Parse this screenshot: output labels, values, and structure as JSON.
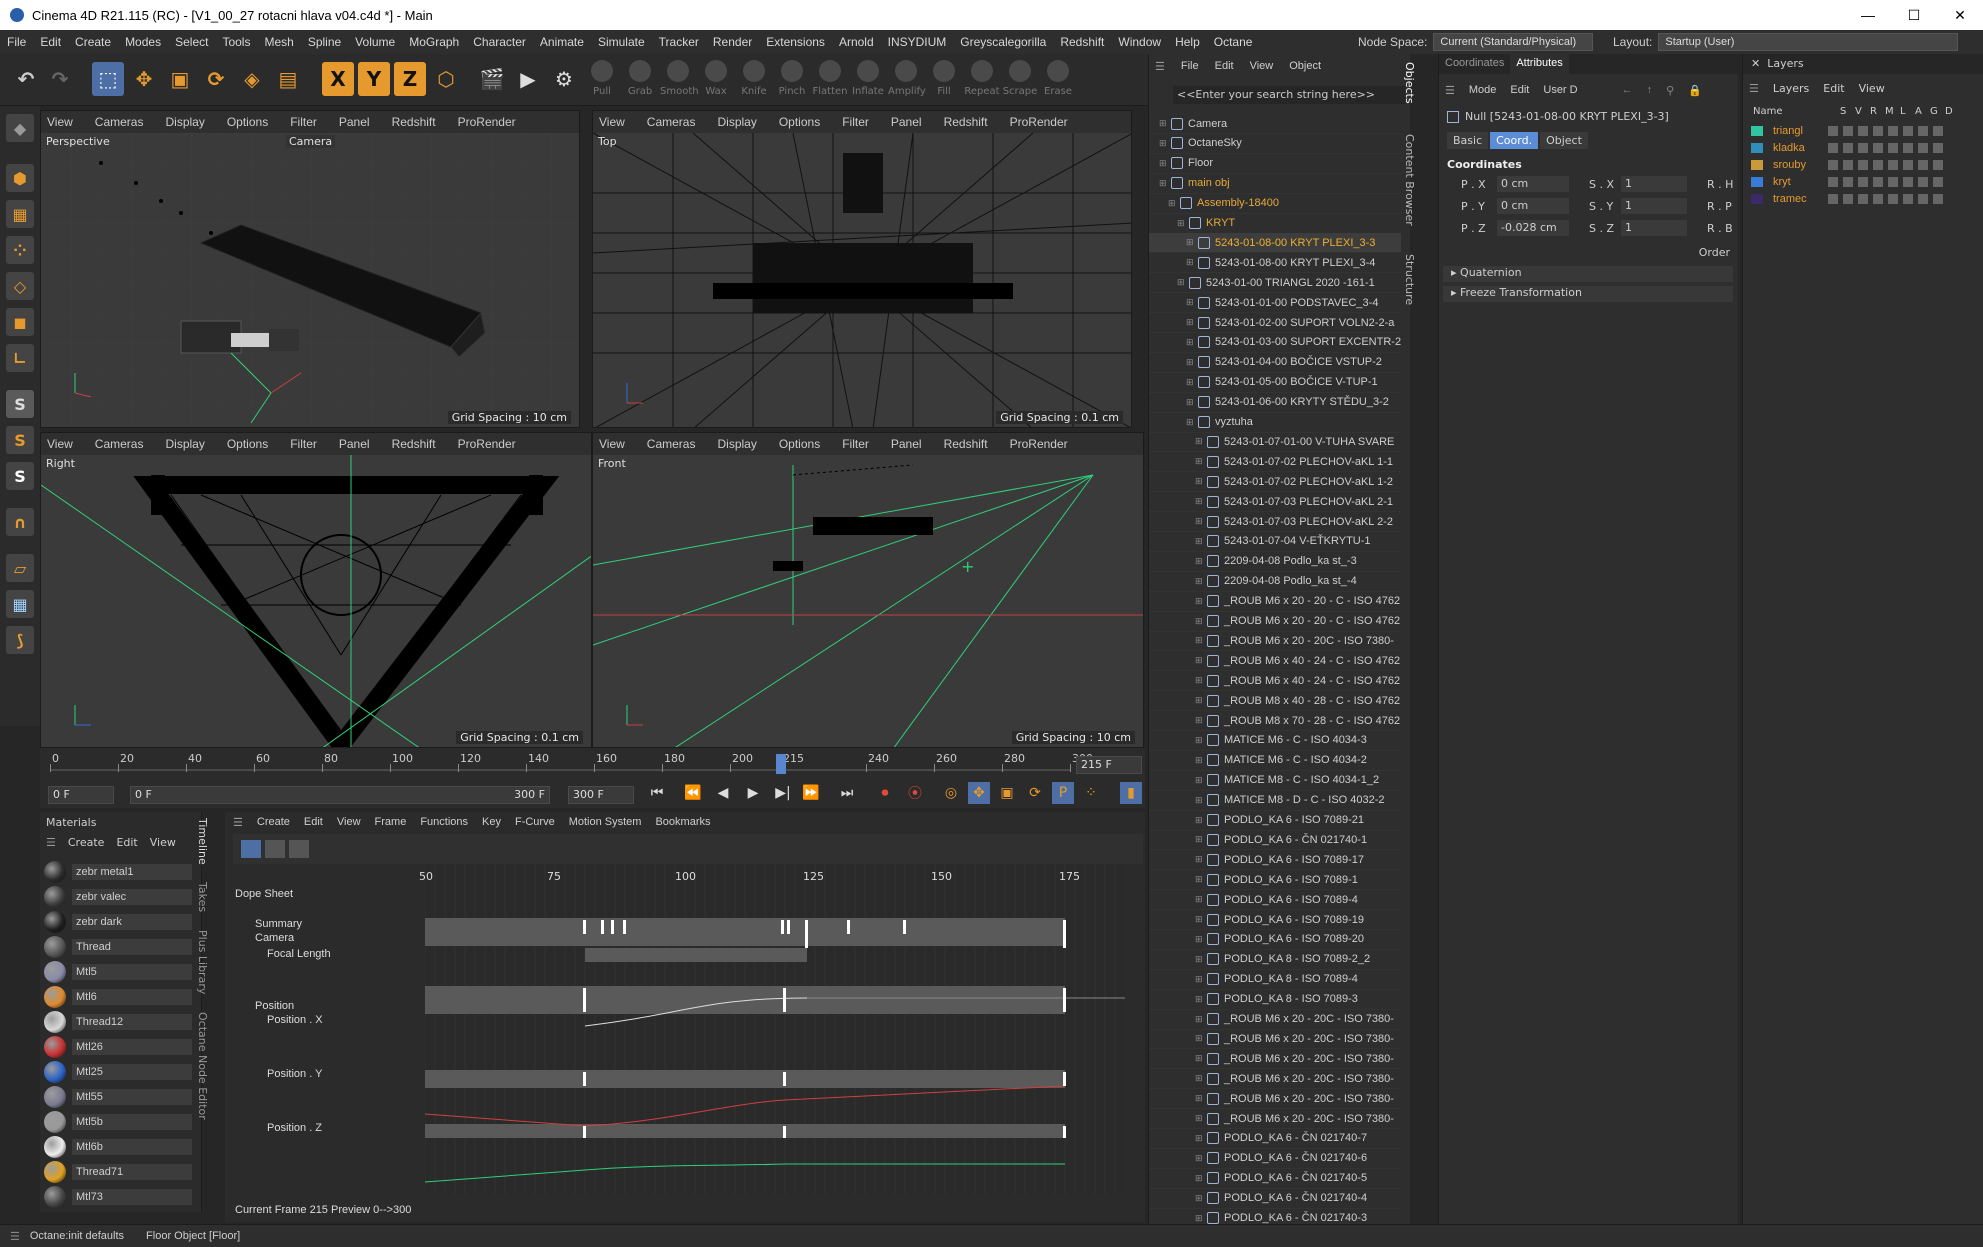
{
  "window": {
    "title": "Cinema 4D R21.115 (RC) - [V1_00_27 rotacni hlava v04.c4d *] - Main",
    "min": "—",
    "max": "☐",
    "close": "✕"
  },
  "menu": [
    "File",
    "Edit",
    "Create",
    "Modes",
    "Select",
    "Tools",
    "Mesh",
    "Spline",
    "Volume",
    "MoGraph",
    "Character",
    "Animate",
    "Simulate",
    "Tracker",
    "Render",
    "Extensions",
    "Arnold",
    "INSYDIUM",
    "Greyscalegorilla",
    "Redshift",
    "Window",
    "Help",
    "Octane"
  ],
  "node_space": {
    "label": "Node Space:",
    "value": "Current (Standard/Physical)"
  },
  "layout": {
    "label": "Layout:",
    "value": "Startup (User)"
  },
  "sculpt_tools": [
    "Pull",
    "Grab",
    "Smooth",
    "Wax",
    "Knife",
    "Pinch",
    "Flatten",
    "Inflate",
    "Amplify",
    "Fill",
    "Repeat",
    "Scrape",
    "Erase"
  ],
  "axis_buttons": [
    "X",
    "Y",
    "Z"
  ],
  "viewport_menu": [
    "View",
    "Cameras",
    "Display",
    "Options",
    "Filter",
    "Panel",
    "Redshift",
    "ProRender"
  ],
  "viewports": [
    {
      "label": "Perspective",
      "camera": "Camera",
      "grid": "Grid Spacing : 10 cm"
    },
    {
      "label": "Top",
      "grid": "Grid Spacing : 0.1 cm"
    },
    {
      "label": "Right",
      "grid": "Grid Spacing : 0.1 cm"
    },
    {
      "label": "Front",
      "grid": "Grid Spacing : 10 cm"
    }
  ],
  "timeline": {
    "ruler": [
      "0",
      "20",
      "40",
      "60",
      "80",
      "100",
      "120",
      "140",
      "160",
      "180",
      "200",
      "215",
      "240",
      "260",
      "280",
      "300"
    ],
    "end_frame": "215 F",
    "start": "0 F",
    "min": "0 F",
    "max": "300 F",
    "end": "300 F"
  },
  "materials": {
    "tab": "Materials",
    "menu": [
      "Create",
      "Edit",
      "View"
    ],
    "items": [
      {
        "name": "zebr metal1",
        "color": "#2a2a2a"
      },
      {
        "name": "zebr valec",
        "color": "#3a3a3a"
      },
      {
        "name": "zebr dark",
        "color": "#1e1e1e"
      },
      {
        "name": "Thread",
        "color": "#555555"
      },
      {
        "name": "Mtl5",
        "color": "#8a8aa8"
      },
      {
        "name": "Mtl6",
        "color": "#e08a2e"
      },
      {
        "name": "Thread12",
        "color": "#d8d8d8"
      },
      {
        "name": "Mtl26",
        "color": "#c83030"
      },
      {
        "name": "Mtl25",
        "color": "#2a62c8"
      },
      {
        "name": "Mtl55",
        "color": "#7a7a90"
      },
      {
        "name": "Mtl5b",
        "color": "#999999"
      },
      {
        "name": "Mtl6b",
        "color": "#eeeeee"
      },
      {
        "name": "Thread71",
        "color": "#e0a020"
      },
      {
        "name": "Mtl73",
        "color": "#444444"
      }
    ]
  },
  "dope": {
    "menu": [
      "Create",
      "Edit",
      "View",
      "Frame",
      "Functions",
      "Key",
      "F-Curve",
      "Motion System",
      "Bookmarks"
    ],
    "title": "Dope Sheet",
    "ruler": [
      "50",
      "75",
      "100",
      "125",
      "150",
      "175"
    ],
    "tracks": [
      "Summary",
      "Camera",
      "Focal Length",
      "Position",
      "Position . X",
      "Position . Y",
      "Position . Z"
    ],
    "sidetabs": [
      "Timeline",
      "Takes",
      "Plus Library",
      "Octane Node Editor"
    ],
    "status": "Current Frame  215   Preview   0-->300"
  },
  "objects": {
    "menu": [
      "File",
      "Edit",
      "View",
      "Object"
    ],
    "search": "<<Enter your search string here>>",
    "tree": [
      {
        "n": "Camera",
        "d": 0
      },
      {
        "n": "OctaneSky",
        "d": 0
      },
      {
        "n": "Floor",
        "d": 0
      },
      {
        "n": "main obj",
        "d": 0,
        "c": "#e6a93a"
      },
      {
        "n": "Assembly-18400",
        "d": 1,
        "c": "#e6a93a"
      },
      {
        "n": "KRYT",
        "d": 2,
        "c": "#e6a93a"
      },
      {
        "n": "5243-01-08-00 KRYT PLEXI_3-3",
        "d": 3,
        "c": "#f0b030"
      },
      {
        "n": "5243-01-08-00 KRYT PLEXI_3-4",
        "d": 3
      },
      {
        "n": "5243-01-00 TRIANGL 2020 -161-1",
        "d": 2
      },
      {
        "n": "5243-01-01-00 PODSTAVEC_3-4",
        "d": 3
      },
      {
        "n": "5243-01-02-00 SUPORT VOLN2-2-a",
        "d": 3
      },
      {
        "n": "5243-01-03-00 SUPORT EXCENTR-2",
        "d": 3
      },
      {
        "n": "5243-01-04-00 BOČICE VSTUP-2",
        "d": 3
      },
      {
        "n": "5243-01-05-00 BOČICE V-TUP-1",
        "d": 3
      },
      {
        "n": "5243-01-06-00 KRYTY STĚDU_3-2",
        "d": 3
      },
      {
        "n": "vyztuha",
        "d": 3
      },
      {
        "n": "5243-01-07-01-00 V-TUHA SVARE",
        "d": 4
      },
      {
        "n": "5243-01-07-02 PLECHOV-aKL 1-1",
        "d": 4
      },
      {
        "n": "5243-01-07-02 PLECHOV-aKL 1-2",
        "d": 4
      },
      {
        "n": "5243-01-07-03 PLECHOV-aKL 2-1",
        "d": 4
      },
      {
        "n": "5243-01-07-03 PLECHOV-aKL 2-2",
        "d": 4
      },
      {
        "n": "5243-01-07-04 V-EŤKRYTU-1",
        "d": 4
      },
      {
        "n": "2209-04-08 Podlo_ka st_-3",
        "d": 4
      },
      {
        "n": "2209-04-08 Podlo_ka st_-4",
        "d": 4
      },
      {
        "n": "_ROUB M6 x 20 - 20 - C - ISO 4762",
        "d": 4
      },
      {
        "n": "_ROUB M6 x 20 - 20 - C - ISO 4762",
        "d": 4
      },
      {
        "n": "_ROUB M6 x 20 - 20C - ISO 7380-",
        "d": 4
      },
      {
        "n": "_ROUB M6 x 40 - 24 - C - ISO 4762",
        "d": 4
      },
      {
        "n": "_ROUB M6 x 40 - 24 - C - ISO 4762",
        "d": 4
      },
      {
        "n": "_ROUB M8 x 40 - 28 - C - ISO 4762",
        "d": 4
      },
      {
        "n": "_ROUB M8 x 70 - 28 - C - ISO 4762",
        "d": 4
      },
      {
        "n": "MATICE M6 - C - ISO 4034-3",
        "d": 4
      },
      {
        "n": "MATICE M6 - C - ISO 4034-2",
        "d": 4
      },
      {
        "n": "MATICE M8 - C - ISO 4034-1_2",
        "d": 4
      },
      {
        "n": "MATICE M8 - D - C - ISO 4032-2",
        "d": 4
      },
      {
        "n": "PODLO_KA 6 - ISO 7089-21",
        "d": 4
      },
      {
        "n": "PODLO_KA 6 - ČN 021740-1",
        "d": 4
      },
      {
        "n": "PODLO_KA 6 - ISO 7089-17",
        "d": 4
      },
      {
        "n": "PODLO_KA 6 - ISO 7089-1",
        "d": 4
      },
      {
        "n": "PODLO_KA 6 - ISO 7089-4",
        "d": 4
      },
      {
        "n": "PODLO_KA 6 - ISO 7089-19",
        "d": 4
      },
      {
        "n": "PODLO_KA 6 - ISO 7089-20",
        "d": 4
      },
      {
        "n": "PODLO_KA 8 - ISO 7089-2_2",
        "d": 4
      },
      {
        "n": "PODLO_KA 8 - ISO 7089-4",
        "d": 4
      },
      {
        "n": "PODLO_KA 8 - ISO 7089-3",
        "d": 4
      },
      {
        "n": "_ROUB M6 x 20 - 20C - ISO 7380-",
        "d": 4
      },
      {
        "n": "_ROUB M6 x 20 - 20C - ISO 7380-",
        "d": 4
      },
      {
        "n": "_ROUB M6 x 20 - 20C - ISO 7380-",
        "d": 4
      },
      {
        "n": "_ROUB M6 x 20 - 20C - ISO 7380-",
        "d": 4
      },
      {
        "n": "_ROUB M6 x 20 - 20C - ISO 7380-",
        "d": 4
      },
      {
        "n": "_ROUB M6 x 20 - 20C - ISO 7380-",
        "d": 4
      },
      {
        "n": "PODLO_KA 6 - ČN 021740-7",
        "d": 4
      },
      {
        "n": "PODLO_KA 6 - ČN 021740-6",
        "d": 4
      },
      {
        "n": "PODLO_KA 6 - ČN 021740-5",
        "d": 4
      },
      {
        "n": "PODLO_KA 6 - ČN 021740-4",
        "d": 4
      },
      {
        "n": "PODLO_KA 6 - ČN 021740-3",
        "d": 4
      }
    ]
  },
  "side_tabs": [
    "Objects",
    "Content Browser",
    "Structure"
  ],
  "attributes": {
    "tabs": [
      "Coordinates",
      "Attributes"
    ],
    "menu": [
      "Mode",
      "Edit",
      "User D"
    ],
    "object": "Null [5243-01-08-00 KRYT PLEXI_3-3]",
    "subtabs": [
      "Basic",
      "Coord.",
      "Object"
    ],
    "section": "Coordinates",
    "rows": [
      [
        "P . X",
        "0 cm",
        "S . X",
        "1",
        "R . H"
      ],
      [
        "P . Y",
        "0 cm",
        "S . Y",
        "1",
        "R . P"
      ],
      [
        "P . Z",
        "-0.028 cm",
        "S . Z",
        "1",
        "R . B"
      ]
    ],
    "order": "Order",
    "groups": [
      "Quaternion",
      "Freeze Transformation"
    ]
  },
  "layers": {
    "title": "Layers",
    "menu": [
      "Layers",
      "Edit",
      "View"
    ],
    "cols": [
      "Name",
      "S",
      "V",
      "R",
      "M",
      "L",
      "A",
      "G",
      "D"
    ],
    "items": [
      {
        "n": "triangl",
        "c": "#2fc6a0"
      },
      {
        "n": "kladka",
        "c": "#2f8fb8"
      },
      {
        "n": "srouby",
        "c": "#c89a3a"
      },
      {
        "n": "kryt",
        "c": "#3a7ad8"
      },
      {
        "n": "tramec",
        "c": "#3a2a6a"
      }
    ]
  },
  "status": {
    "left": "Octane:init defaults",
    "right": "Floor Object [Floor]"
  }
}
